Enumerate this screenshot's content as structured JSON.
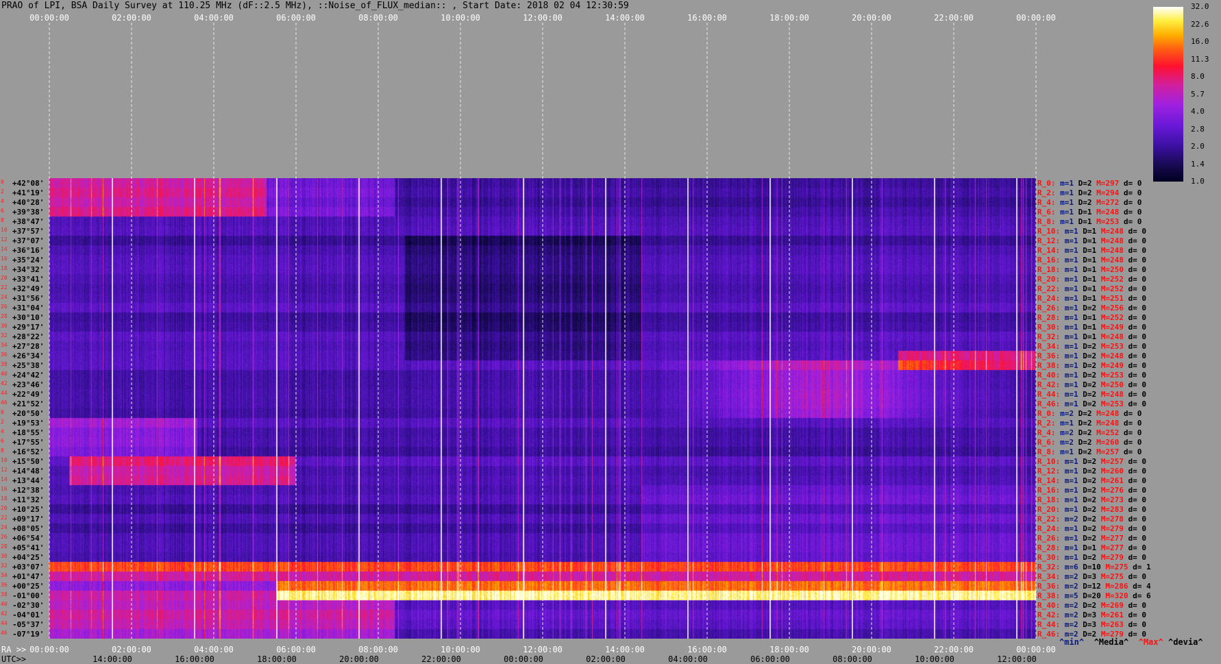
{
  "title": "PRAO of LPI, BSA Daily Survey at 110.25 MHz (dF::2.5 MHz), ::Noise_of_FLUX_median:: , Start Date: 2018 02 04 12:30:59",
  "top_axis_ticks": [
    "00:00:00",
    "02:00:00",
    "04:00:00",
    "06:00:00",
    "08:00:00",
    "10:00:00",
    "12:00:00",
    "14:00:00",
    "16:00:00",
    "18:00:00",
    "20:00:00",
    "22:00:00",
    "00:00:00"
  ],
  "ra_label": "RA >>",
  "ra_ticks": [
    "00:00:00",
    "02:00:00",
    "04:00:00",
    "06:00:00",
    "08:00:00",
    "10:00:00",
    "12:00:00",
    "14:00:00",
    "16:00:00",
    "18:00:00",
    "20:00:00",
    "22:00:00",
    "00:00:00"
  ],
  "utc_label": "UTC>>",
  "utc_ticks": [
    "14:00:00",
    "16:00:00",
    "18:00:00",
    "20:00:00",
    "22:00:00",
    "00:00:00",
    "02:00:00",
    "04:00:00",
    "06:00:00",
    "08:00:00",
    "10:00:00",
    "12:00:00"
  ],
  "color_scale": {
    "labels": [
      "32.0",
      "22.6",
      "16.0",
      "11.3",
      "8.0",
      "5.7",
      "4.0",
      "2.8",
      "2.0",
      "1.4",
      "1.0"
    ]
  },
  "rows": [
    {
      "idx": "0",
      "dec": "+42°08'",
      "stat": {
        "r": "R_0:",
        "m": "m=1",
        "d": "D=2",
        "mx": "M=297",
        "dv": "d= 0"
      }
    },
    {
      "idx": "2",
      "dec": "+41°19'",
      "stat": {
        "r": "R_2:",
        "m": "m=1",
        "d": "D=2",
        "mx": "M=294",
        "dv": "d= 0"
      }
    },
    {
      "idx": "4",
      "dec": "+40°28'",
      "stat": {
        "r": "R_4:",
        "m": "m=1",
        "d": "D=2",
        "mx": "M=272",
        "dv": "d= 0"
      }
    },
    {
      "idx": "6",
      "dec": "+39°38'",
      "stat": {
        "r": "R_6:",
        "m": "m=1",
        "d": "D=1",
        "mx": "M=248",
        "dv": "d= 0"
      }
    },
    {
      "idx": "8",
      "dec": "+38°47'",
      "stat": {
        "r": "R_8:",
        "m": "m=1",
        "d": "D=1",
        "mx": "M=253",
        "dv": "d= 0"
      }
    },
    {
      "idx": "10",
      "dec": "+37°57'",
      "stat": {
        "r": "R_10:",
        "m": "m=1",
        "d": "D=1",
        "mx": "M=248",
        "dv": "d= 0"
      }
    },
    {
      "idx": "12",
      "dec": "+37°07'",
      "stat": {
        "r": "R_12:",
        "m": "m=1",
        "d": "D=1",
        "mx": "M=248",
        "dv": "d= 0"
      }
    },
    {
      "idx": "14",
      "dec": "+36°16'",
      "stat": {
        "r": "R_14:",
        "m": "m=1",
        "d": "D=1",
        "mx": "M=248",
        "dv": "d= 0"
      }
    },
    {
      "idx": "16",
      "dec": "+35°24'",
      "stat": {
        "r": "R_16:",
        "m": "m=1",
        "d": "D=1",
        "mx": "M=248",
        "dv": "d= 0"
      }
    },
    {
      "idx": "18",
      "dec": "+34°32'",
      "stat": {
        "r": "R_18:",
        "m": "m=1",
        "d": "D=1",
        "mx": "M=250",
        "dv": "d= 0"
      }
    },
    {
      "idx": "20",
      "dec": "+33°41'",
      "stat": {
        "r": "R_20:",
        "m": "m=1",
        "d": "D=1",
        "mx": "M=252",
        "dv": "d= 0"
      }
    },
    {
      "idx": "22",
      "dec": "+32°49'",
      "stat": {
        "r": "R_22:",
        "m": "m=1",
        "d": "D=1",
        "mx": "M=252",
        "dv": "d= 0"
      }
    },
    {
      "idx": "24",
      "dec": "+31°56'",
      "stat": {
        "r": "R_24:",
        "m": "m=1",
        "d": "D=1",
        "mx": "M=251",
        "dv": "d= 0"
      }
    },
    {
      "idx": "26",
      "dec": "+31°04'",
      "stat": {
        "r": "R_26:",
        "m": "m=1",
        "d": "D=2",
        "mx": "M=256",
        "dv": "d= 0"
      }
    },
    {
      "idx": "28",
      "dec": "+30°10'",
      "stat": {
        "r": "R_28:",
        "m": "m=1",
        "d": "D=1",
        "mx": "M=252",
        "dv": "d= 0"
      }
    },
    {
      "idx": "30",
      "dec": "+29°17'",
      "stat": {
        "r": "R_30:",
        "m": "m=1",
        "d": "D=1",
        "mx": "M=249",
        "dv": "d= 0"
      }
    },
    {
      "idx": "32",
      "dec": "+28°22'",
      "stat": {
        "r": "R_32:",
        "m": "m=1",
        "d": "D=1",
        "mx": "M=248",
        "dv": "d= 0"
      }
    },
    {
      "idx": "34",
      "dec": "+27°28'",
      "stat": {
        "r": "R_34:",
        "m": "m=1",
        "d": "D=2",
        "mx": "M=253",
        "dv": "d= 0"
      }
    },
    {
      "idx": "36",
      "dec": "+26°34'",
      "stat": {
        "r": "R_36:",
        "m": "m=1",
        "d": "D=2",
        "mx": "M=248",
        "dv": "d= 0"
      }
    },
    {
      "idx": "38",
      "dec": "+25°38'",
      "stat": {
        "r": "R_38:",
        "m": "m=1",
        "d": "D=2",
        "mx": "M=249",
        "dv": "d= 0"
      }
    },
    {
      "idx": "40",
      "dec": "+24°42'",
      "stat": {
        "r": "R_40:",
        "m": "m=1",
        "d": "D=2",
        "mx": "M=253",
        "dv": "d= 0"
      }
    },
    {
      "idx": "42",
      "dec": "+23°46'",
      "stat": {
        "r": "R_42:",
        "m": "m=1",
        "d": "D=2",
        "mx": "M=250",
        "dv": "d= 0"
      }
    },
    {
      "idx": "44",
      "dec": "+22°49'",
      "stat": {
        "r": "R_44:",
        "m": "m=1",
        "d": "D=2",
        "mx": "M=248",
        "dv": "d= 0"
      }
    },
    {
      "idx": "46",
      "dec": "+21°52'",
      "stat": {
        "r": "R_46:",
        "m": "m=1",
        "d": "D=2",
        "mx": "M=253",
        "dv": "d= 0"
      }
    },
    {
      "idx": "0",
      "dec": "+20°50'",
      "stat": {
        "r": "R_0:",
        "m": "m=2",
        "d": "D=2",
        "mx": "M=248",
        "dv": "d= 0"
      }
    },
    {
      "idx": "2",
      "dec": "+19°53'",
      "stat": {
        "r": "R_2:",
        "m": "m=1",
        "d": "D=2",
        "mx": "M=248",
        "dv": "d= 0"
      }
    },
    {
      "idx": "4",
      "dec": "+18°55'",
      "stat": {
        "r": "R_4:",
        "m": "m=2",
        "d": "D=2",
        "mx": "M=252",
        "dv": "d= 0"
      }
    },
    {
      "idx": "6",
      "dec": "+17°55'",
      "stat": {
        "r": "R_6:",
        "m": "m=2",
        "d": "D=2",
        "mx": "M=260",
        "dv": "d= 0"
      }
    },
    {
      "idx": "8",
      "dec": "+16°52'",
      "stat": {
        "r": "R_8:",
        "m": "m=1",
        "d": "D=2",
        "mx": "M=257",
        "dv": "d= 0"
      }
    },
    {
      "idx": "10",
      "dec": "+15°50'",
      "stat": {
        "r": "R_10:",
        "m": "m=1",
        "d": "D=2",
        "mx": "M=257",
        "dv": "d= 0"
      }
    },
    {
      "idx": "12",
      "dec": "+14°48'",
      "stat": {
        "r": "R_12:",
        "m": "m=1",
        "d": "D=2",
        "mx": "M=260",
        "dv": "d= 0"
      }
    },
    {
      "idx": "14",
      "dec": "+13°44'",
      "stat": {
        "r": "R_14:",
        "m": "m=1",
        "d": "D=2",
        "mx": "M=261",
        "dv": "d= 0"
      }
    },
    {
      "idx": "16",
      "dec": "+12°38'",
      "stat": {
        "r": "R_16:",
        "m": "m=1",
        "d": "D=2",
        "mx": "M=276",
        "dv": "d= 0"
      }
    },
    {
      "idx": "18",
      "dec": "+11°32'",
      "stat": {
        "r": "R_18:",
        "m": "m=1",
        "d": "D=2",
        "mx": "M=273",
        "dv": "d= 0"
      }
    },
    {
      "idx": "20",
      "dec": "+10°25'",
      "stat": {
        "r": "R_20:",
        "m": "m=1",
        "d": "D=2",
        "mx": "M=283",
        "dv": "d= 0"
      }
    },
    {
      "idx": "22",
      "dec": "+09°17'",
      "stat": {
        "r": "R_22:",
        "m": "m=2",
        "d": "D=2",
        "mx": "M=278",
        "dv": "d= 0"
      }
    },
    {
      "idx": "24",
      "dec": "+08°05'",
      "stat": {
        "r": "R_24:",
        "m": "m=1",
        "d": "D=2",
        "mx": "M=279",
        "dv": "d= 0"
      }
    },
    {
      "idx": "26",
      "dec": "+06°54'",
      "stat": {
        "r": "R_26:",
        "m": "m=1",
        "d": "D=2",
        "mx": "M=277",
        "dv": "d= 0"
      }
    },
    {
      "idx": "28",
      "dec": "+05°41'",
      "stat": {
        "r": "R_28:",
        "m": "m=1",
        "d": "D=1",
        "mx": "M=277",
        "dv": "d= 0"
      }
    },
    {
      "idx": "30",
      "dec": "+04°25'",
      "stat": {
        "r": "R_30:",
        "m": "m=1",
        "d": "D=2",
        "mx": "M=279",
        "dv": "d= 0"
      }
    },
    {
      "idx": "32",
      "dec": "+03°07'",
      "stat": {
        "r": "R_32:",
        "m": "m=6",
        "d": "D=10",
        "mx": "M=275",
        "dv": "d= 1"
      }
    },
    {
      "idx": "34",
      "dec": "+01°47'",
      "stat": {
        "r": "R_34:",
        "m": "m=2",
        "d": "D=3",
        "mx": "M=275",
        "dv": "d= 0"
      }
    },
    {
      "idx": "36",
      "dec": "+00°25'",
      "stat": {
        "r": "R_36:",
        "m": "m=2",
        "d": "D=12",
        "mx": "M=286",
        "dv": "d= 4"
      }
    },
    {
      "idx": "38",
      "dec": "-01°00'",
      "stat": {
        "r": "R_38:",
        "m": "m=5",
        "d": "D=20",
        "mx": "M=320",
        "dv": "d= 6"
      }
    },
    {
      "idx": "40",
      "dec": "-02°30'",
      "stat": {
        "r": "R_40:",
        "m": "m=2",
        "d": "D=2",
        "mx": "M=269",
        "dv": "d= 0"
      }
    },
    {
      "idx": "42",
      "dec": "-04°01'",
      "stat": {
        "r": "R_42:",
        "m": "m=2",
        "d": "D=3",
        "mx": "M=261",
        "dv": "d= 0"
      }
    },
    {
      "idx": "44",
      "dec": "-05°37'",
      "stat": {
        "r": "R_44:",
        "m": "m=2",
        "d": "D=3",
        "mx": "M=263",
        "dv": "d= 0"
      }
    },
    {
      "idx": "46",
      "dec": "-07°19'",
      "stat": {
        "r": "R_46:",
        "m": "m=2",
        "d": "D=2",
        "mx": "M=279",
        "dv": "d= 0"
      }
    }
  ],
  "footer_legend": {
    "min": "^min^",
    "median": "^Media^",
    "max": "^Max^",
    "devia": "^devia^"
  }
}
